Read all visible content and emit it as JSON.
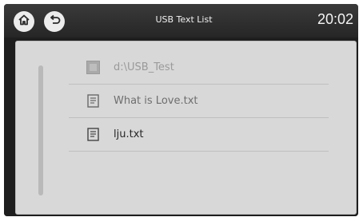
{
  "titlebar": {
    "home_icon": "home-icon",
    "back_icon": "back-arrow-icon",
    "title": "USB Text List",
    "clock": "20:02"
  },
  "list": {
    "items": [
      {
        "label": "d:\\USB_Test",
        "icon": "folder-icon"
      },
      {
        "label": "What is Love.txt",
        "icon": "text-file-icon"
      },
      {
        "label": "lju.txt",
        "icon": "text-file-icon"
      }
    ]
  },
  "colors": {
    "titlebar": "#2e2e2e",
    "panel": "#d8d8d8",
    "button": "#ececec"
  }
}
